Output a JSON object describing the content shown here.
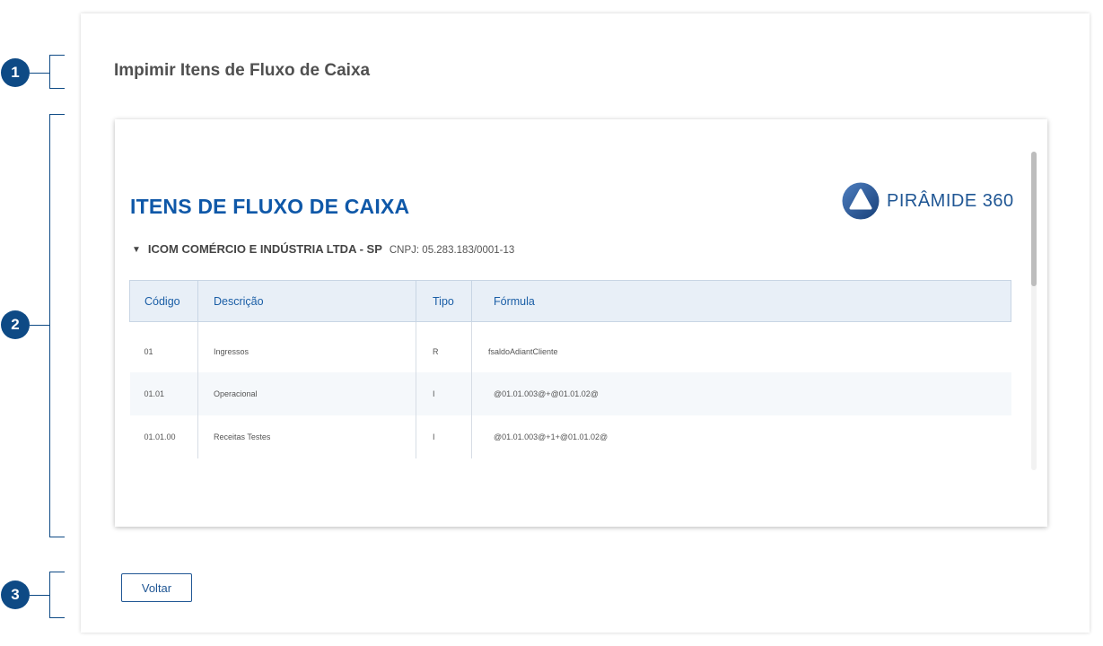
{
  "annotations": [
    "1",
    "2",
    "3"
  ],
  "page": {
    "title": "Impimir Itens de Fluxo de Caixa"
  },
  "report": {
    "title": "ITENS DE FLUXO DE CAIXA",
    "brand": {
      "name": "PIRÂMIDE 360",
      "icon": "piramide-logo-icon",
      "color": "#1f5694"
    },
    "company": {
      "name": "ICOM COMÉRCIO E INDÚSTRIA LTDA - SP",
      "cnpj": "CNPJ: 05.283.183/0001-13"
    },
    "table": {
      "headers": [
        "Código",
        "Descrição",
        "Tipo",
        "Fórmula"
      ],
      "rows": [
        {
          "codigo": "01",
          "descricao": "Ingressos",
          "tipo": "R",
          "formula": "fsaldoAdiantCliente"
        },
        {
          "codigo": "01.01",
          "descricao": "Operacional",
          "tipo": "I",
          "formula": "@01.01.003@+@01.01.02@"
        },
        {
          "codigo": "01.01.00",
          "descricao": "Receitas Testes",
          "tipo": "I",
          "formula": "@01.01.003@+1+@01.01.02@"
        }
      ]
    }
  },
  "actions": {
    "back_label": "Voltar"
  },
  "colors": {
    "accent": "#0e4a85",
    "report_title": "#0f58a8",
    "table_header_bg": "#e8eff7"
  }
}
